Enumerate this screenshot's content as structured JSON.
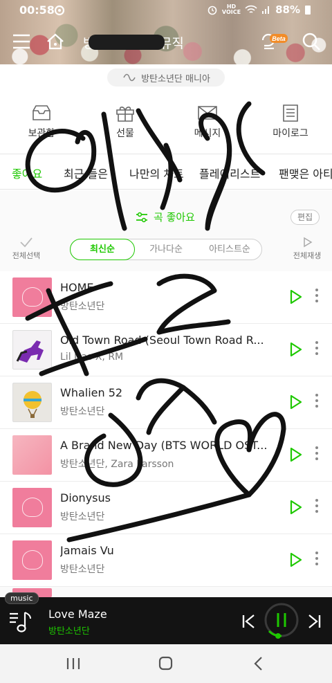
{
  "status": {
    "time": "00:58",
    "hd_top": "HD",
    "hd_bottom": "VOICE",
    "battery": "88%"
  },
  "header": {
    "title": "방탄소년단의 뮤직",
    "beta_badge": "Beta"
  },
  "mania": {
    "label": "방탄소년단 매니아"
  },
  "quick_menu": [
    {
      "label": "보관함",
      "icon": "tray-icon"
    },
    {
      "label": "선물",
      "icon": "gift-icon"
    },
    {
      "label": "메시지",
      "icon": "mail-icon"
    },
    {
      "label": "마이로그",
      "icon": "log-icon"
    }
  ],
  "tabs": [
    "좋아요",
    "최근 들은",
    "나만의 차트",
    "플레이리스트",
    "팬맺은 아티"
  ],
  "filter": {
    "label": "곡 좋아요",
    "edit": "편집"
  },
  "controls": {
    "select_all": "전체선택",
    "play_all": "전체재생"
  },
  "sort": [
    "최신순",
    "가나다순",
    "아티스트순"
  ],
  "songs": [
    {
      "title": "HOME",
      "artist": "방탄소년단"
    },
    {
      "title": "Old Town Road (Seoul Town Road R...",
      "artist": "Lil Nas X, RM"
    },
    {
      "title": "Whalien 52",
      "artist": "방탄소년단"
    },
    {
      "title": "A Brand New Day (BTS WORLD OST...",
      "artist": "방탄소년단, Zara Larsson"
    },
    {
      "title": "Dionysus",
      "artist": "방탄소년단"
    },
    {
      "title": "Jamais Vu",
      "artist": "방탄소년단"
    }
  ],
  "player": {
    "badge": "music",
    "title": "Love Maze",
    "artist": "방탄소년단"
  },
  "colors": {
    "accent": "#1ec800",
    "player_bg": "#131313"
  }
}
